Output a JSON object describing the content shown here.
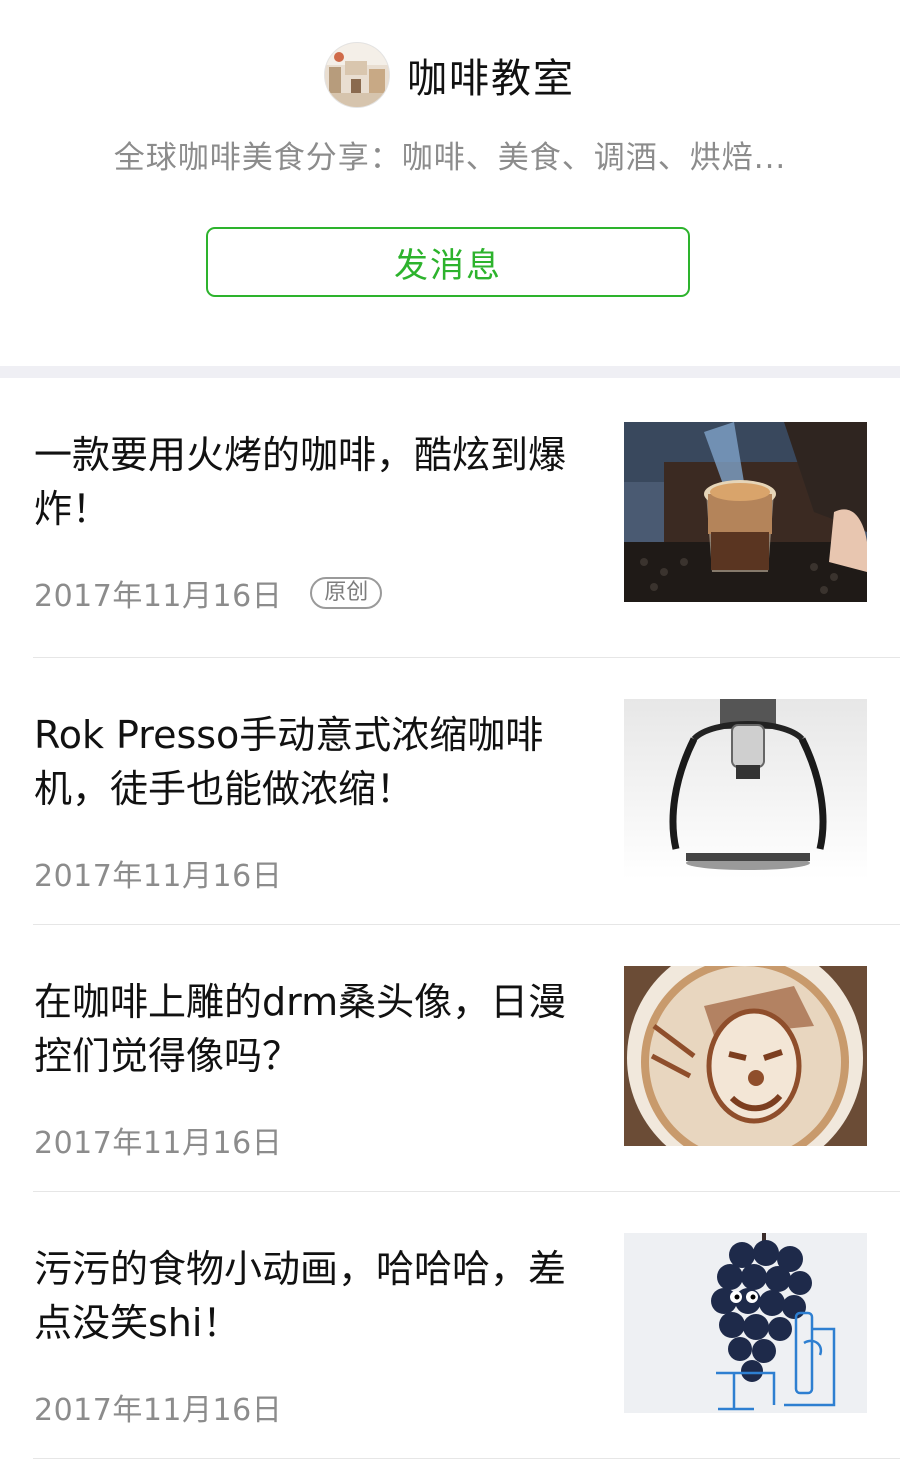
{
  "account": {
    "name": "咖啡教室",
    "description": "全球咖啡美食分享：咖啡、美食、调酒、烘焙...",
    "message_button": "发消息"
  },
  "articles": [
    {
      "title": "一款要用火烤的咖啡，酷炫到爆炸！",
      "date": "2017年11月16日",
      "tag": "原创",
      "thumb_icon": "torched-coffee-image"
    },
    {
      "title": "Rok Presso手动意式浓缩咖啡机，徒手也能做浓缩！",
      "date": "2017年11月16日",
      "tag": "",
      "thumb_icon": "espresso-machine-image"
    },
    {
      "title": "在咖啡上雕的drm桑头像，日漫控们觉得像吗？",
      "date": "2017年11月16日",
      "tag": "",
      "thumb_icon": "latte-art-image"
    },
    {
      "title": "污污的食物小动画，哈哈哈，差点没笑shi！",
      "date": "2017年11月16日",
      "tag": "",
      "thumb_icon": "grapes-cartoon-image"
    }
  ]
}
